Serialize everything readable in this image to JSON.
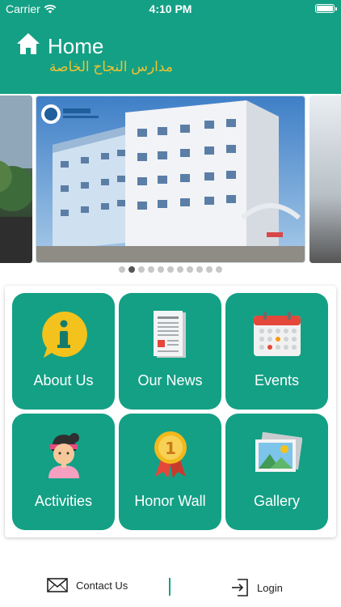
{
  "status_bar": {
    "carrier": "Carrier",
    "time": "4:10 PM"
  },
  "app_bar": {
    "title": "Home",
    "subtitle": "مدارس النجاح الخاصة"
  },
  "carousel": {
    "slide_count": 11,
    "active_index": 1
  },
  "menu": {
    "tiles": [
      {
        "label": "About Us",
        "icon": "info-icon"
      },
      {
        "label": "Our News",
        "icon": "newspaper-icon"
      },
      {
        "label": "Events",
        "icon": "calendar-icon"
      },
      {
        "label": "Activities",
        "icon": "student-icon"
      },
      {
        "label": "Honor Wall",
        "icon": "medal-icon"
      },
      {
        "label": "Gallery",
        "icon": "picture-icon"
      }
    ]
  },
  "bottom_bar": {
    "contact_label": "Contact Us",
    "login_label": "Login"
  },
  "colors": {
    "primary": "#14a085",
    "accent": "#f2c230"
  }
}
